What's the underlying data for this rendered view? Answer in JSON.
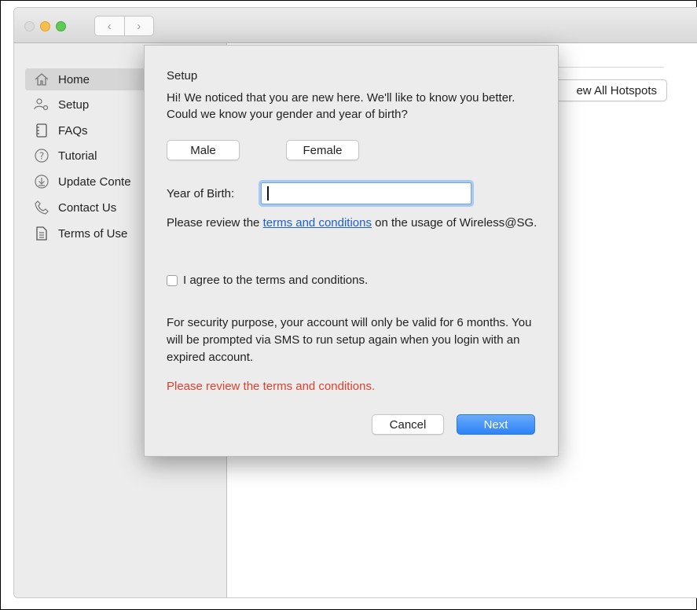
{
  "toolbar": {
    "back_icon": "‹",
    "forward_icon": "›"
  },
  "sidebar": {
    "items": [
      {
        "label": "Home",
        "icon": "home-icon"
      },
      {
        "label": "Setup",
        "icon": "setup-icon"
      },
      {
        "label": "FAQs",
        "icon": "faqs-icon"
      },
      {
        "label": "Tutorial",
        "icon": "help-icon"
      },
      {
        "label": "Update Conte",
        "icon": "download-icon"
      },
      {
        "label": "Contact Us",
        "icon": "phone-icon"
      },
      {
        "label": "Terms of Use",
        "icon": "document-icon"
      }
    ]
  },
  "main": {
    "view_all_label": "ew All Hotspots"
  },
  "dialog": {
    "title": "Setup",
    "intro": "Hi! We noticed that you are new here. We'll like to know you better. Could we know your gender and year of birth?",
    "male_label": "Male",
    "female_label": "Female",
    "yob_label": "Year of Birth:",
    "yob_value": "",
    "review_prefix": "Please review the ",
    "review_link": "terms and conditions",
    "review_suffix": " on the usage of Wireless@SG.",
    "agree_label": "I agree to the terms and conditions.",
    "agree_checked": false,
    "security_text": "For security purpose, your account will only be valid for 6 months. You will be prompted via SMS to run setup again when you login with an expired account.",
    "error_text": "Please review the terms and conditions.",
    "cancel_label": "Cancel",
    "next_label": "Next"
  },
  "colors": {
    "accent": "#2d83f7",
    "error": "#e03f2e",
    "link": "#1f5fcc"
  }
}
